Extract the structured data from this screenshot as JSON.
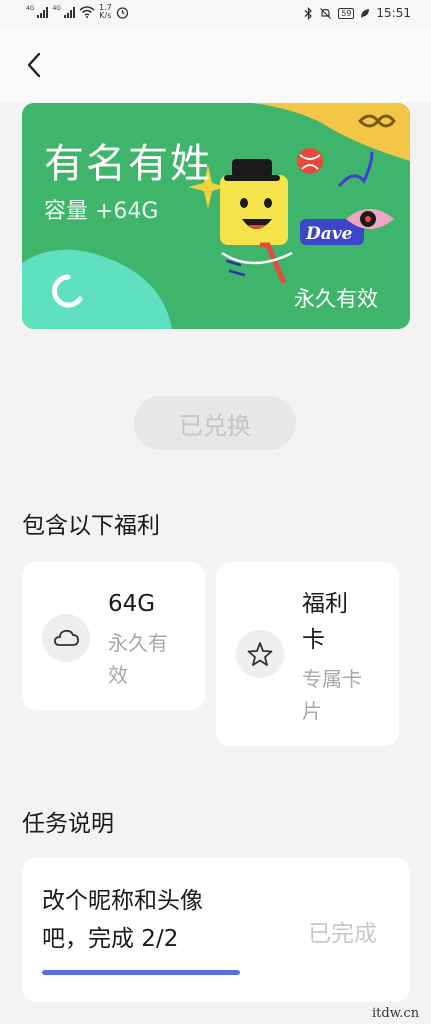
{
  "status_bar": {
    "sim1": "4G",
    "sim2": "4G",
    "speed_value": "1.7",
    "speed_unit": "K/s",
    "battery": "59",
    "time": "15:51"
  },
  "card": {
    "title": "有名有姓",
    "capacity": "容量 +64G",
    "validity": "永久有效",
    "mascot_tag": "Dave",
    "colors": {
      "background": "#3fb56b",
      "corner_yellow": "#f3c646",
      "corner_teal": "#5fe0c0"
    }
  },
  "redeem": {
    "label": "已兑换"
  },
  "benefits": {
    "heading": "包含以下福利",
    "items": [
      {
        "icon": "cloud-icon",
        "title": "64G",
        "desc_line1": "永久有",
        "desc_line2": "效"
      },
      {
        "icon": "star-icon",
        "title_line1": "福利",
        "title_line2": "卡",
        "desc_line1": "专属卡",
        "desc_line2": "片"
      }
    ]
  },
  "task": {
    "heading": "任务说明",
    "text_line1": "改个昵称和头像",
    "text_line2": "吧，完成 2/2",
    "status": "已完成",
    "progress": 1.0,
    "progress_color": "#5570e0"
  },
  "watermark": "itdw.cn"
}
